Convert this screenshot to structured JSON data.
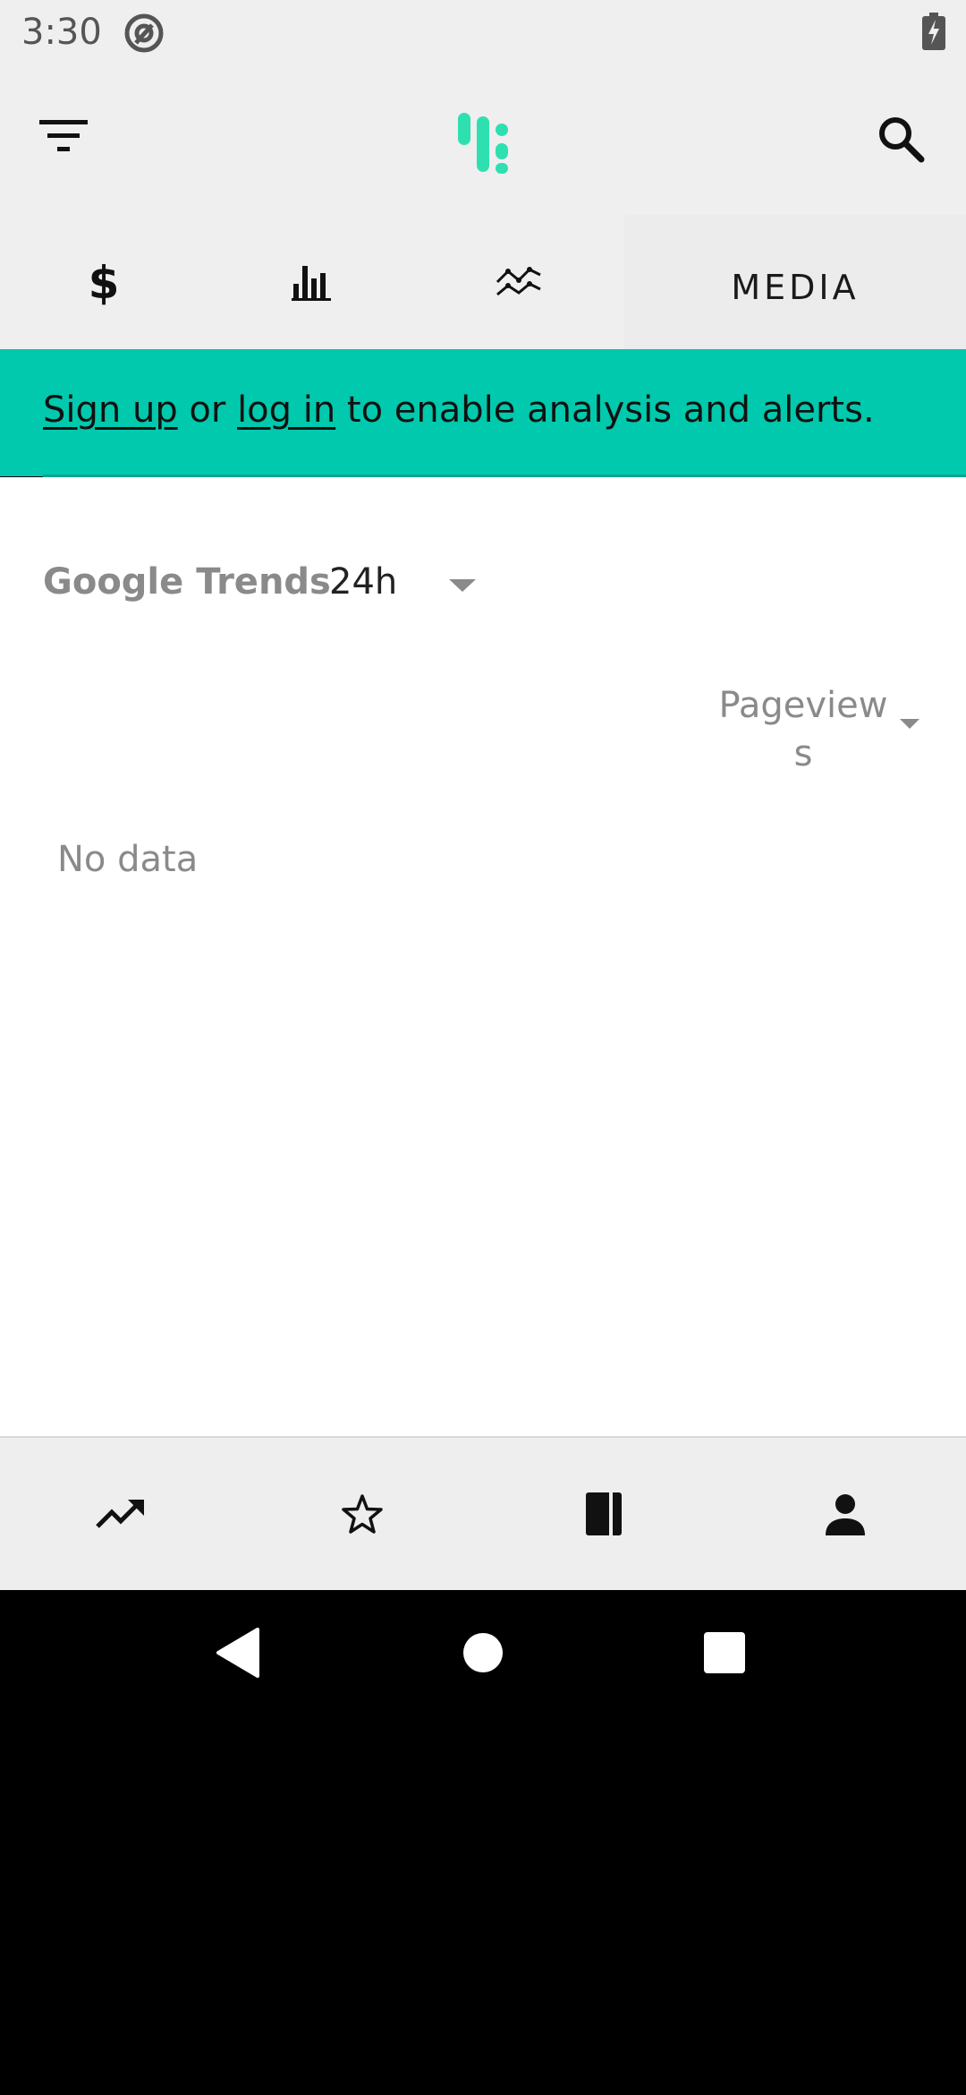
{
  "status_bar": {
    "time": "3:30",
    "left_icon": "at-sign-icon",
    "battery_icon": "battery-charging-icon"
  },
  "app_bar": {
    "filter_icon": "filter-list-icon",
    "logo_icon": "app-logo-icon",
    "search_icon": "search-icon"
  },
  "tabs": [
    {
      "icon": "dollar-icon",
      "label": ""
    },
    {
      "icon": "bar-chart-icon",
      "label": ""
    },
    {
      "icon": "line-chart-icon",
      "label": ""
    },
    {
      "icon": "",
      "label": "MEDIA"
    }
  ],
  "banner": {
    "signup_label": "Sign up",
    "or_text": " or ",
    "login_label": "log in",
    "rest_text": " to enable analysis and alerts.",
    "background_color": "#00c9ad"
  },
  "content": {
    "title": "Google Trends",
    "range_selected": "24h",
    "metric_selected": "Pageviews",
    "empty_text": "No data"
  },
  "bottom_nav": [
    {
      "icon": "trending-up-icon"
    },
    {
      "icon": "star-outline-icon"
    },
    {
      "icon": "book-icon"
    },
    {
      "icon": "person-icon"
    }
  ],
  "system_nav": {
    "back_icon": "back-triangle-icon",
    "home_icon": "home-circle-icon",
    "recents_icon": "recents-square-icon"
  },
  "colors": {
    "accent": "#00c9ad",
    "logo": "#2ee0b0",
    "header_bg": "#efefef"
  }
}
